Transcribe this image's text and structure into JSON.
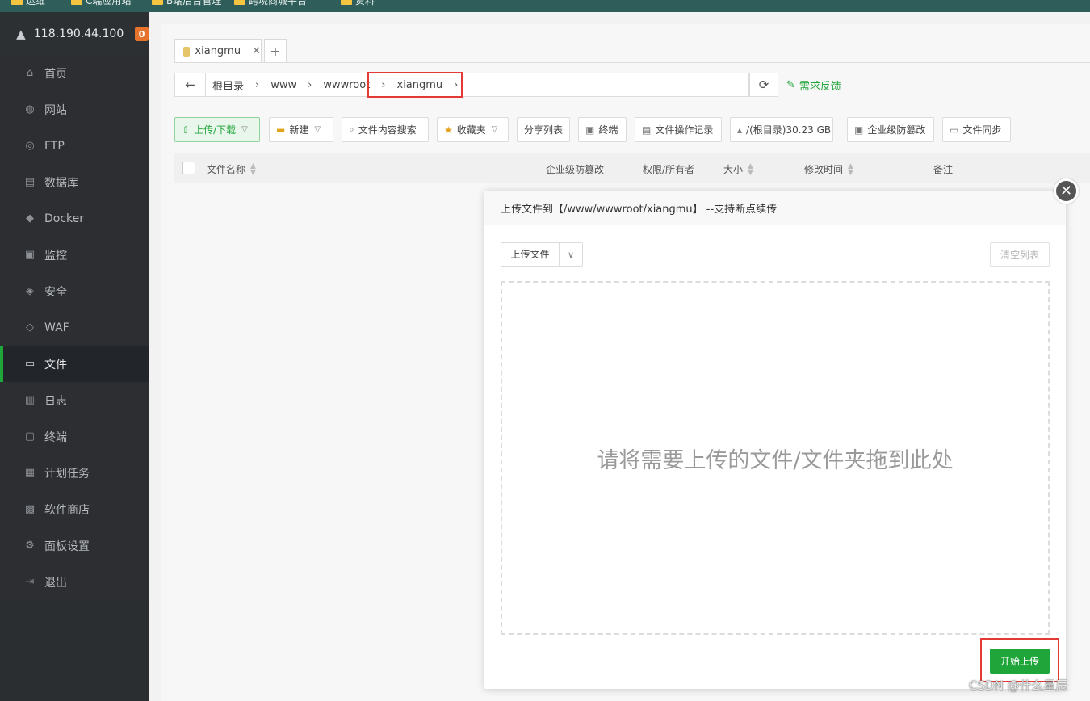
{
  "bookmarks": [
    {
      "label": "运维"
    },
    {
      "label": "C端应用站"
    },
    {
      "label": "B端后台管理"
    },
    {
      "label": "跨境商城平台"
    },
    {
      "label": "资料"
    }
  ],
  "sidebar": {
    "ip": "118.190.44.100",
    "badge": "0",
    "items": [
      {
        "label": "首页",
        "icon": "home-icon",
        "glyph": "⌂"
      },
      {
        "label": "网站",
        "icon": "globe-icon",
        "glyph": "◍"
      },
      {
        "label": "FTP",
        "icon": "ftp-icon",
        "glyph": "◎"
      },
      {
        "label": "数据库",
        "icon": "database-icon",
        "glyph": "▤"
      },
      {
        "label": "Docker",
        "icon": "docker-icon",
        "glyph": "◆"
      },
      {
        "label": "监控",
        "icon": "monitor-icon",
        "glyph": "▣"
      },
      {
        "label": "安全",
        "icon": "shield-icon",
        "glyph": "◈"
      },
      {
        "label": "WAF",
        "icon": "waf-shield-icon",
        "glyph": "◇"
      },
      {
        "label": "文件",
        "icon": "folder-icon",
        "glyph": "▭",
        "active": true
      },
      {
        "label": "日志",
        "icon": "log-icon",
        "glyph": "▥"
      },
      {
        "label": "终端",
        "icon": "terminal-icon",
        "glyph": "▢"
      },
      {
        "label": "计划任务",
        "icon": "calendar-icon",
        "glyph": "▦"
      },
      {
        "label": "软件商店",
        "icon": "apps-icon",
        "glyph": "▩"
      },
      {
        "label": "面板设置",
        "icon": "gear-icon",
        "glyph": "⚙"
      },
      {
        "label": "退出",
        "icon": "logout-icon",
        "glyph": "⇥"
      }
    ]
  },
  "tabs": [
    {
      "label": "xiangmu"
    }
  ],
  "path": {
    "crumbs": [
      "根目录",
      "www",
      "wwwroot",
      "xiangmu"
    ],
    "feedback": "需求反馈"
  },
  "toolbar": {
    "upload_download": "上传/下载",
    "new": "新建",
    "search_content": "文件内容搜索",
    "favorites": "收藏夹",
    "share_list": "分享列表",
    "terminal": "终端",
    "operation_log": "文件操作记录",
    "disk": "/(根目录)30.23 GB",
    "tamper_proof": "企业级防篡改",
    "file_sync": "文件同步"
  },
  "table": {
    "columns": [
      "文件名称",
      "企业级防篡改",
      "权限/所有者",
      "大小",
      "修改时间",
      "备注"
    ]
  },
  "dialog": {
    "title": "上传文件到【/www/wwwroot/xiangmu】 --支持断点续传",
    "upload_select": "上传文件",
    "clear_list": "清空列表",
    "drop_message": "请将需要上传的文件/文件夹拖到此处",
    "start_upload": "开始上传"
  },
  "watermark": "CSDN @什么星辰",
  "colors": {
    "accent": "#20a53a",
    "highlight": "#e53935",
    "sidebar": "#2a2c2f"
  }
}
